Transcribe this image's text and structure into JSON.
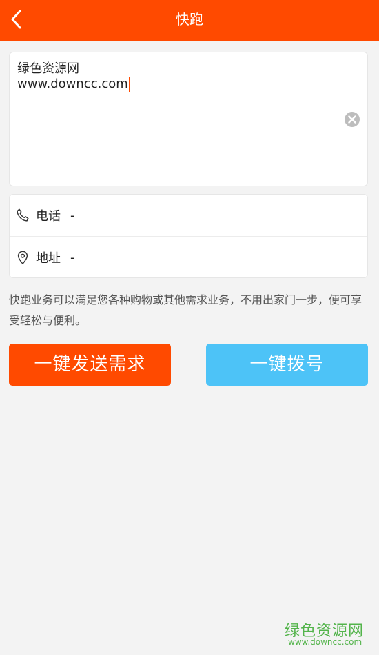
{
  "header": {
    "title": "快跑",
    "back_icon": "chevron-left-icon"
  },
  "note": {
    "value": "绿色资源网\nwww.downcc.com",
    "clear_icon": "clear-circle-icon"
  },
  "contact": {
    "phone_icon": "phone-icon",
    "phone_label": "电话",
    "phone_value": "-",
    "address_icon": "location-pin-icon",
    "address_label": "地址",
    "address_value": "-"
  },
  "description": "快跑业务可以满足您各种购物或其他需求业务，不用出家门一步，便可享受轻松与便利。",
  "buttons": {
    "send_label": "一键发送需求",
    "dial_label": "一键拨号"
  },
  "watermark": {
    "title": "绿色资源网",
    "url": "www.downcc.com"
  },
  "colors": {
    "accent": "#ff4a00",
    "dial_button": "#4dc3f7",
    "background": "#f3f3f3",
    "watermark": "#53b44b"
  }
}
